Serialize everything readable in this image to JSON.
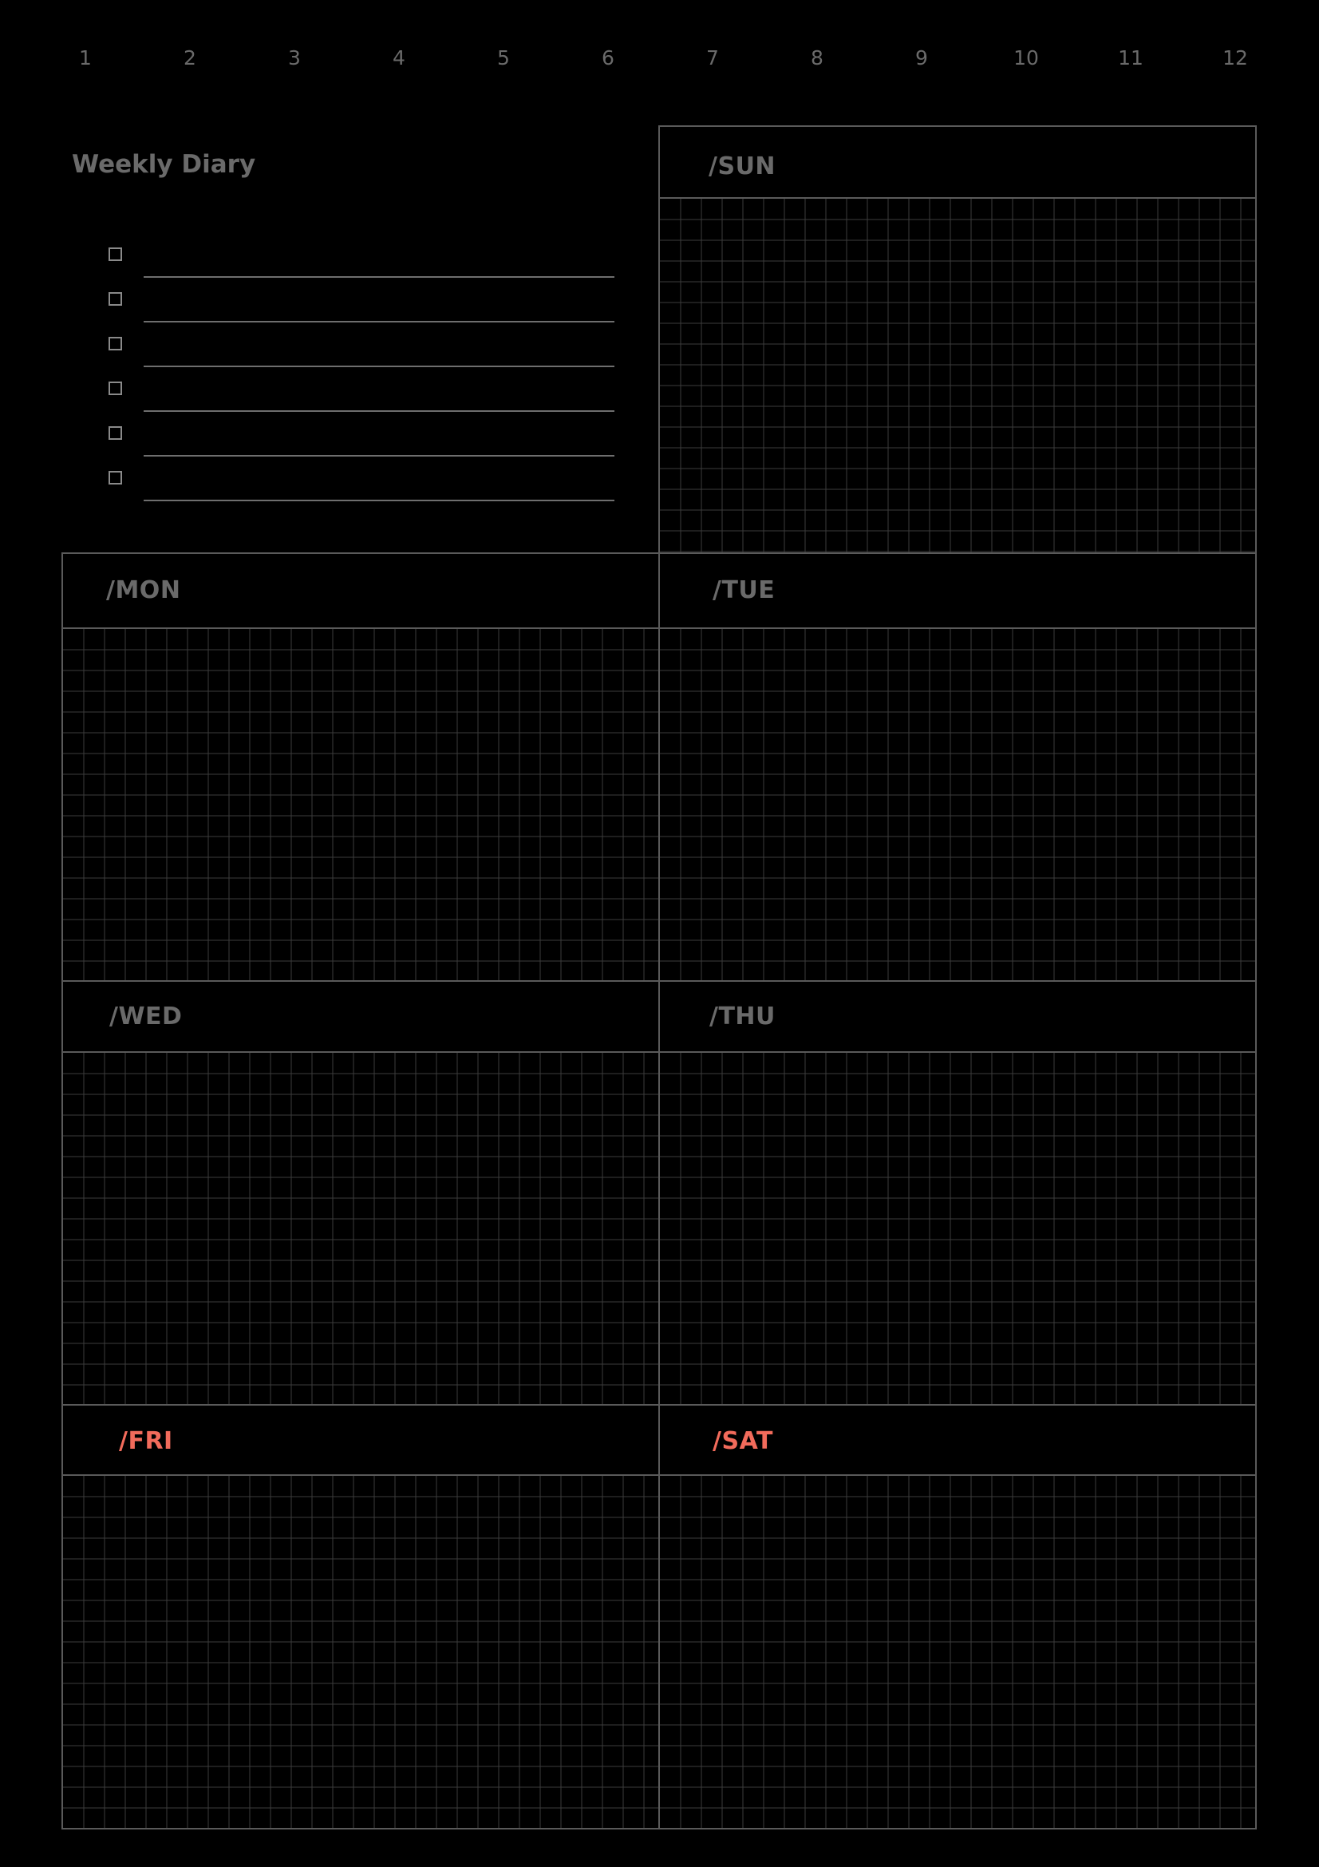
{
  "month_numbers": [
    "1",
    "2",
    "3",
    "4",
    "5",
    "6",
    "7",
    "8",
    "9",
    "10",
    "11",
    "12"
  ],
  "title": "Weekly Diary",
  "todo_count": 6,
  "days": {
    "sun": {
      "label": "/SUN"
    },
    "mon": {
      "label": "/MON"
    },
    "tue": {
      "label": "/TUE"
    },
    "wed": {
      "label": "/WED"
    },
    "thu": {
      "label": "/THU"
    },
    "fri": {
      "label": "/FRI"
    },
    "sat": {
      "label": "/SAT"
    }
  },
  "colors": {
    "background": "#000000",
    "text": "#6a6a6a",
    "accent": "#f26b5b",
    "border": "#5a5a5a",
    "grid": "#3c3c3c"
  }
}
